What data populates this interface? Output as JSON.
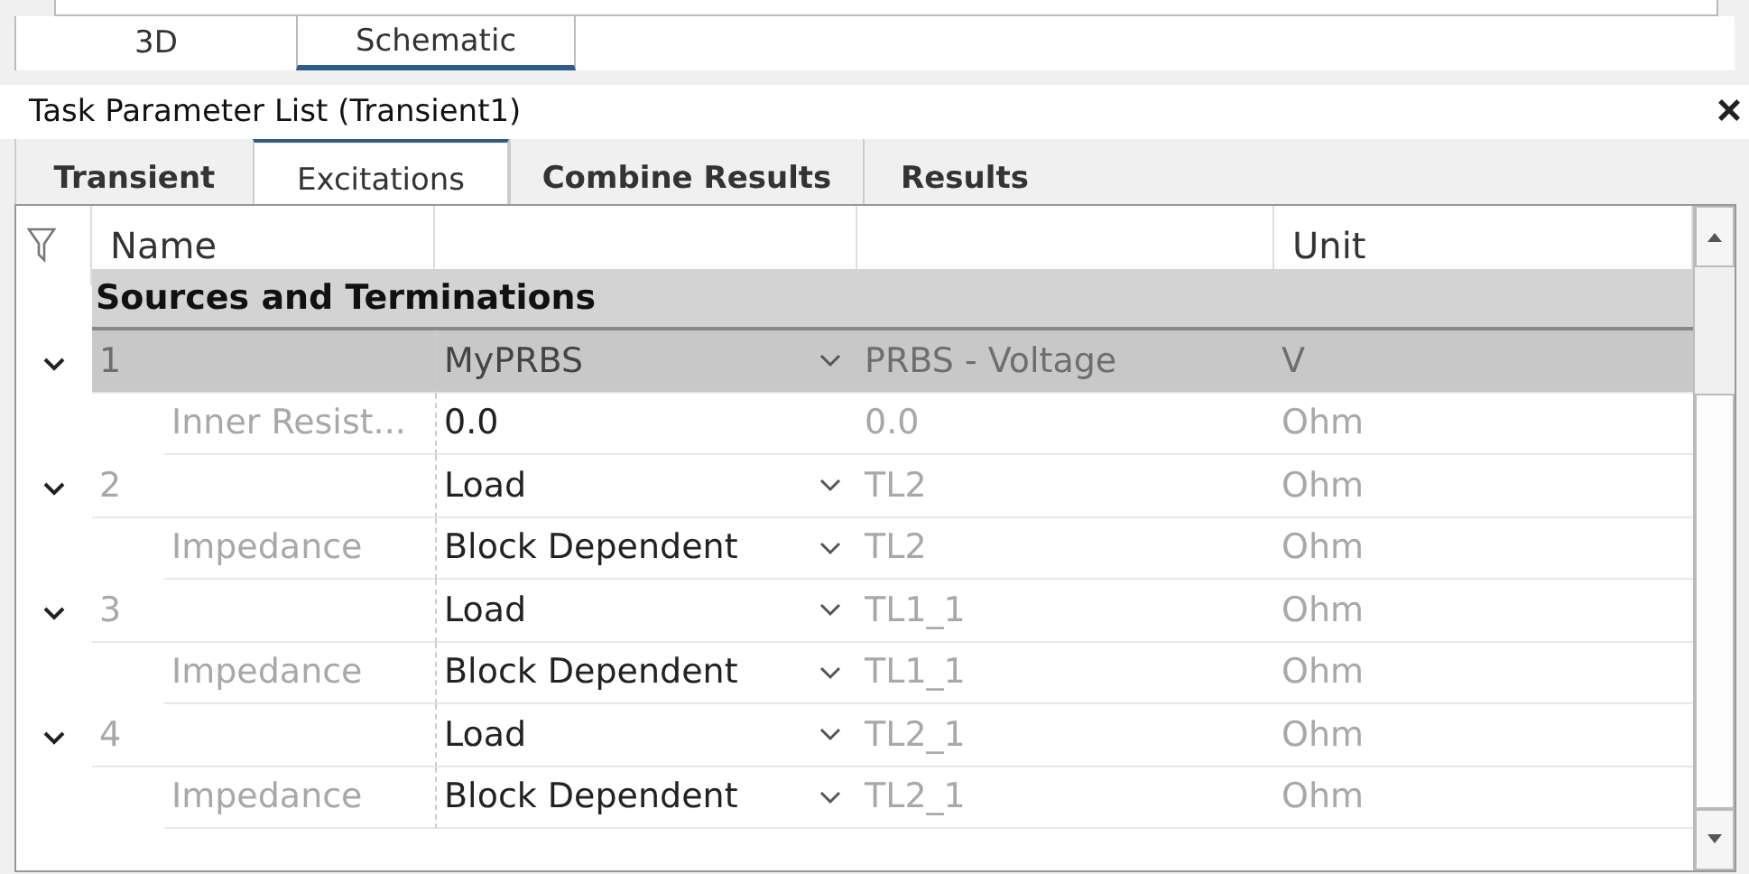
{
  "view_tabs": [
    {
      "label": "3D",
      "selected": false
    },
    {
      "label": "Schematic",
      "selected": true
    }
  ],
  "panel": {
    "title": "Task Parameter List (Transient1)",
    "close": "×"
  },
  "tabs": [
    {
      "label": "Transient",
      "selected": false
    },
    {
      "label": "Excitations",
      "selected": true
    },
    {
      "label": "Combine Results",
      "selected": false
    },
    {
      "label": "Results",
      "selected": false
    }
  ],
  "table": {
    "columns": [
      {
        "label": "Name"
      },
      {},
      {},
      {
        "label": "Unit"
      }
    ],
    "group": "Sources and Terminations",
    "rows": [
      {
        "kind": "parent",
        "expanded": true,
        "selected": true,
        "number": "1",
        "value": "MyPRBS",
        "dropdown": true,
        "type": "PRBS - Voltage",
        "unit": "V"
      },
      {
        "kind": "child",
        "selected": false,
        "name": "Inner Resist...",
        "value": "0.0",
        "dropdown": false,
        "type": "0.0",
        "unit": "Ohm"
      },
      {
        "kind": "parent",
        "expanded": true,
        "selected": false,
        "number": "2",
        "value": "Load",
        "dropdown": true,
        "type": "TL2",
        "unit": "Ohm"
      },
      {
        "kind": "child",
        "selected": false,
        "name": "Impedance",
        "value": "Block Dependent",
        "dropdown": true,
        "type": "TL2",
        "unit": "Ohm"
      },
      {
        "kind": "parent",
        "expanded": true,
        "selected": false,
        "number": "3",
        "value": "Load",
        "dropdown": true,
        "type": "TL1_1",
        "unit": "Ohm"
      },
      {
        "kind": "child",
        "selected": false,
        "name": "Impedance",
        "value": "Block Dependent",
        "dropdown": true,
        "type": "TL1_1",
        "unit": "Ohm"
      },
      {
        "kind": "parent",
        "expanded": true,
        "selected": false,
        "number": "4",
        "value": "Load",
        "dropdown": true,
        "type": "TL2_1",
        "unit": "Ohm"
      },
      {
        "kind": "child",
        "selected": false,
        "name": "Impedance",
        "value": "Block Dependent",
        "dropdown": true,
        "type": "TL2_1",
        "unit": "Ohm"
      }
    ]
  }
}
